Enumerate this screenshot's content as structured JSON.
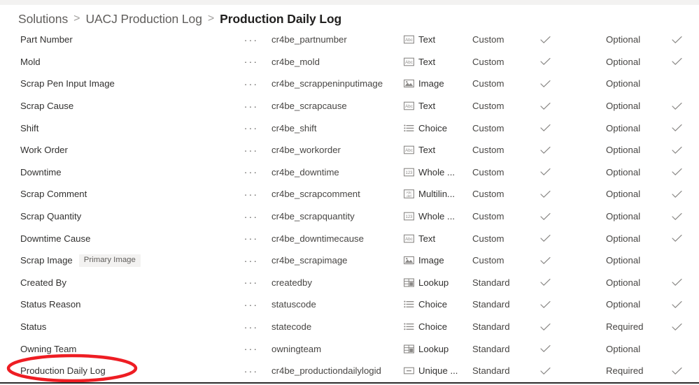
{
  "breadcrumb": {
    "items": [
      {
        "label": "Solutions",
        "current": false
      },
      {
        "label": "UACJ Production Log",
        "current": false
      },
      {
        "label": "Production Daily Log",
        "current": true
      }
    ],
    "separator": ">"
  },
  "grid": {
    "overflow_menu_label": "···",
    "check_glyph": "check-icon",
    "rows": [
      {
        "display_name": "Part Number",
        "badge": null,
        "logical_name": "cr4be_partnumber",
        "data_type": "Text",
        "type_icon": "text-icon",
        "customization": "Custom",
        "searchable": true,
        "required": "Optional",
        "advanced": true
      },
      {
        "display_name": "Mold",
        "badge": null,
        "logical_name": "cr4be_mold",
        "data_type": "Text",
        "type_icon": "text-icon",
        "customization": "Custom",
        "searchable": true,
        "required": "Optional",
        "advanced": true
      },
      {
        "display_name": "Scrap Pen Input Image",
        "badge": null,
        "logical_name": "cr4be_scrappeninputimage",
        "data_type": "Image",
        "type_icon": "image-icon",
        "customization": "Custom",
        "searchable": true,
        "required": "Optional",
        "advanced": false
      },
      {
        "display_name": "Scrap Cause",
        "badge": null,
        "logical_name": "cr4be_scrapcause",
        "data_type": "Text",
        "type_icon": "text-icon",
        "customization": "Custom",
        "searchable": true,
        "required": "Optional",
        "advanced": true
      },
      {
        "display_name": "Shift",
        "badge": null,
        "logical_name": "cr4be_shift",
        "data_type": "Choice",
        "type_icon": "choice-icon",
        "customization": "Custom",
        "searchable": true,
        "required": "Optional",
        "advanced": true
      },
      {
        "display_name": "Work Order",
        "badge": null,
        "logical_name": "cr4be_workorder",
        "data_type": "Text",
        "type_icon": "text-icon",
        "customization": "Custom",
        "searchable": true,
        "required": "Optional",
        "advanced": true
      },
      {
        "display_name": "Downtime",
        "badge": null,
        "logical_name": "cr4be_downtime",
        "data_type": "Whole ...",
        "type_icon": "number-icon",
        "customization": "Custom",
        "searchable": true,
        "required": "Optional",
        "advanced": true
      },
      {
        "display_name": "Scrap Comment",
        "badge": null,
        "logical_name": "cr4be_scrapcomment",
        "data_type": "Multilin...",
        "type_icon": "multiline-icon",
        "customization": "Custom",
        "searchable": true,
        "required": "Optional",
        "advanced": true
      },
      {
        "display_name": "Scrap Quantity",
        "badge": null,
        "logical_name": "cr4be_scrapquantity",
        "data_type": "Whole ...",
        "type_icon": "number-icon",
        "customization": "Custom",
        "searchable": true,
        "required": "Optional",
        "advanced": true
      },
      {
        "display_name": "Downtime Cause",
        "badge": null,
        "logical_name": "cr4be_downtimecause",
        "data_type": "Text",
        "type_icon": "text-icon",
        "customization": "Custom",
        "searchable": true,
        "required": "Optional",
        "advanced": true
      },
      {
        "display_name": "Scrap Image",
        "badge": "Primary Image",
        "logical_name": "cr4be_scrapimage",
        "data_type": "Image",
        "type_icon": "image-icon",
        "customization": "Custom",
        "searchable": true,
        "required": "Optional",
        "advanced": false
      },
      {
        "display_name": "Created By",
        "badge": null,
        "logical_name": "createdby",
        "data_type": "Lookup",
        "type_icon": "lookup-icon",
        "customization": "Standard",
        "searchable": true,
        "required": "Optional",
        "advanced": true
      },
      {
        "display_name": "Status Reason",
        "badge": null,
        "logical_name": "statuscode",
        "data_type": "Choice",
        "type_icon": "choice-icon",
        "customization": "Standard",
        "searchable": true,
        "required": "Optional",
        "advanced": true
      },
      {
        "display_name": "Status",
        "badge": null,
        "logical_name": "statecode",
        "data_type": "Choice",
        "type_icon": "choice-icon",
        "customization": "Standard",
        "searchable": true,
        "required": "Required",
        "advanced": true
      },
      {
        "display_name": "Owning Team",
        "badge": null,
        "logical_name": "owningteam",
        "data_type": "Lookup",
        "type_icon": "lookup-icon",
        "customization": "Standard",
        "searchable": true,
        "required": "Optional",
        "advanced": false
      },
      {
        "display_name": "Production Daily Log",
        "badge": null,
        "logical_name": "cr4be_productiondailylogid",
        "data_type": "Unique ...",
        "type_icon": "unique-icon",
        "customization": "Standard",
        "searchable": true,
        "required": "Required",
        "advanced": true
      }
    ]
  },
  "annotation": {
    "shape": "ellipse",
    "color": "#ee1d23",
    "target_row": "Production Daily Log"
  }
}
